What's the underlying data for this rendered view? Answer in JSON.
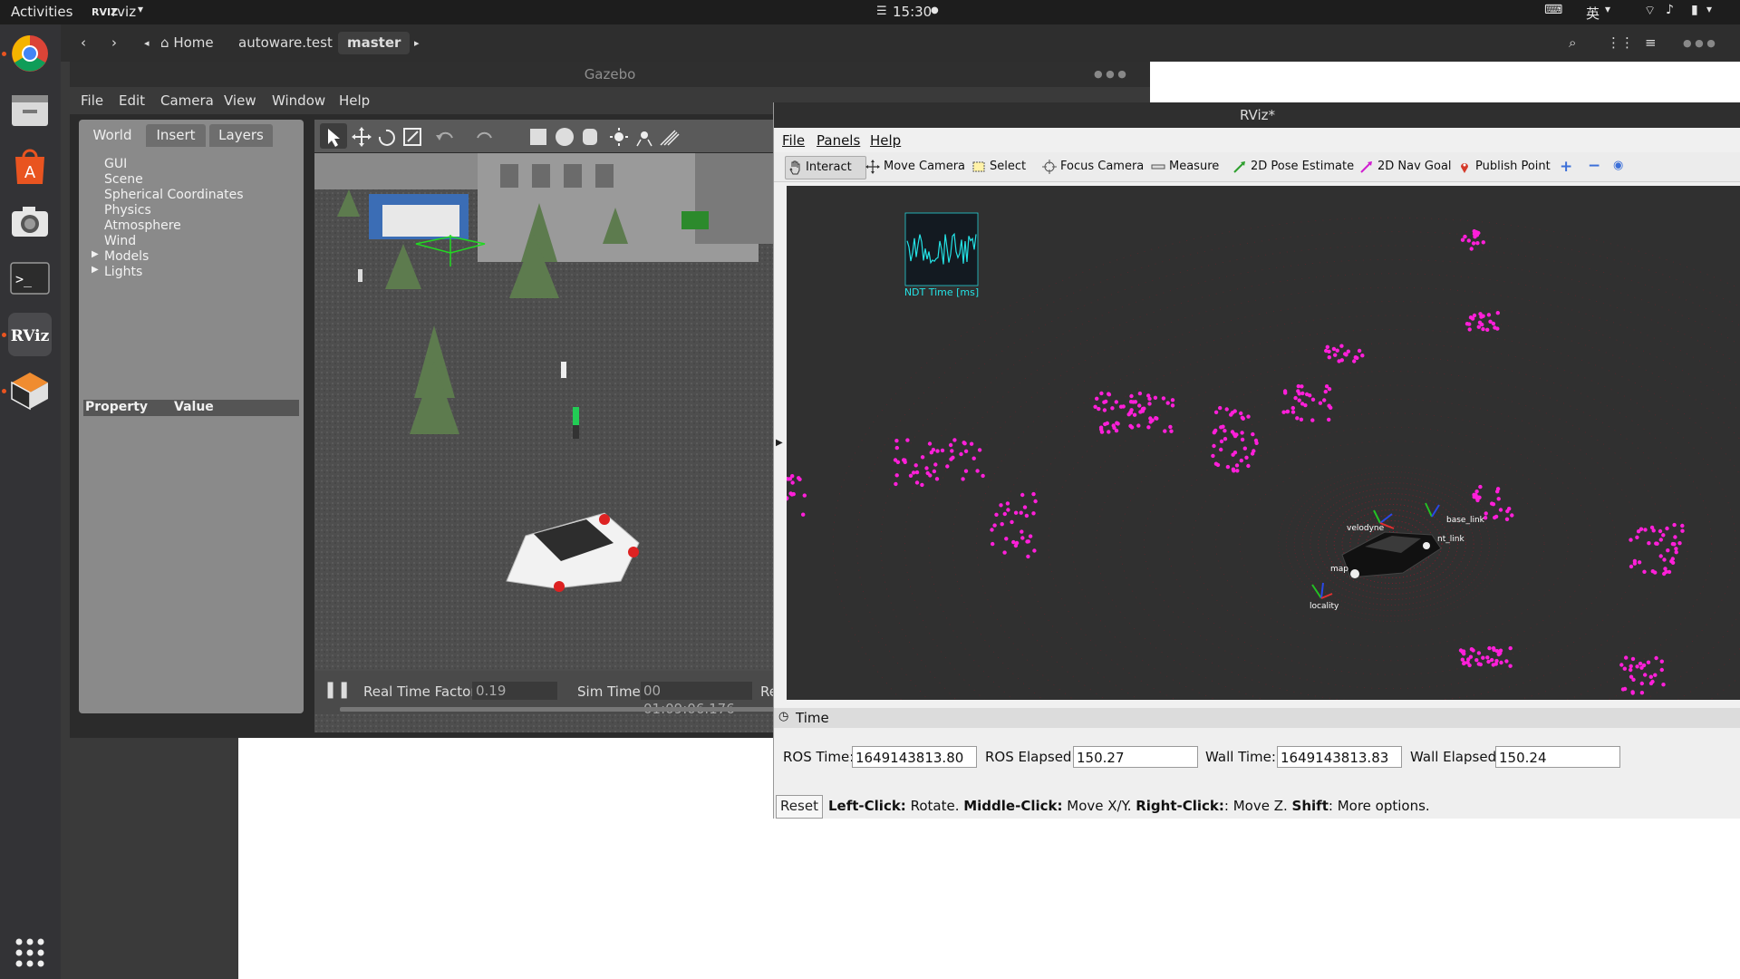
{
  "topbar": {
    "activities": "Activities",
    "app_label": "rviz",
    "app_badge": "RVIZ",
    "clock": "15:30",
    "input_method": "英"
  },
  "dock": {
    "items": [
      {
        "name": "chrome-icon",
        "label": ""
      },
      {
        "name": "files-icon",
        "label": ""
      },
      {
        "name": "software-center-icon",
        "label": "A"
      },
      {
        "name": "screenshot-icon",
        "label": ""
      },
      {
        "name": "terminal-icon",
        "label": ">_"
      },
      {
        "name": "rviz-icon",
        "label": "RViz"
      },
      {
        "name": "3d-box-icon",
        "label": ""
      }
    ]
  },
  "nautilus": {
    "path": [
      "Home",
      "autoware.test",
      "master"
    ]
  },
  "gazebo": {
    "title": "Gazebo",
    "menu": [
      "File",
      "Edit",
      "Camera",
      "View",
      "Window",
      "Help"
    ],
    "tabs": [
      "World",
      "Insert",
      "Layers"
    ],
    "tree": [
      "GUI",
      "Scene",
      "Spherical Coordinates",
      "Physics",
      "Atmosphere",
      "Wind",
      "Models",
      "Lights"
    ],
    "prop_header": {
      "property": "Property",
      "value": "Value"
    },
    "status": {
      "rtf_label": "Real Time Factor:",
      "rtf_value": "0.19",
      "sim_time_label": "Sim Time:",
      "sim_time_value": "00 01:09:06.176",
      "real_time_label": "Real Ti"
    }
  },
  "rviz": {
    "title": "RViz*",
    "menu": [
      "File",
      "Panels",
      "Help"
    ],
    "tools": [
      "Interact",
      "Move Camera",
      "Select",
      "Focus Camera",
      "Measure",
      "2D Pose Estimate",
      "2D Nav Goal",
      "Publish Point"
    ],
    "overlay_label": "NDT Time [ms]",
    "frame_labels": [
      "velodyne",
      "base_link",
      "map",
      "nt_link",
      "locality"
    ],
    "time_panel": {
      "header": "Time",
      "ros_time_label": "ROS Time:",
      "ros_time_value": "1649143813.80",
      "ros_elapsed_label": "ROS Elapsed:",
      "ros_elapsed_value": "150.27",
      "wall_time_label": "Wall Time:",
      "wall_time_value": "1649143813.83",
      "wall_elapsed_label": "Wall Elapsed:",
      "wall_elapsed_value": "150.24"
    },
    "reset_label": "Reset",
    "help": {
      "left_click_key": "Left-Click:",
      "left_click_val": " Rotate. ",
      "middle_click_key": "Middle-Click:",
      "middle_click_val": " Move X/Y. ",
      "right_click_key": "Right-Click:",
      "right_click_val": ": Move Z. ",
      "shift_key": "Shift",
      "shift_val": ": More options."
    }
  },
  "colors": {
    "point_cloud_magenta": "#ff1fd9",
    "lidar_red": "#c0102a",
    "overlay_cyan": "#24e3e6",
    "ubuntu_orange": "#e95420"
  }
}
